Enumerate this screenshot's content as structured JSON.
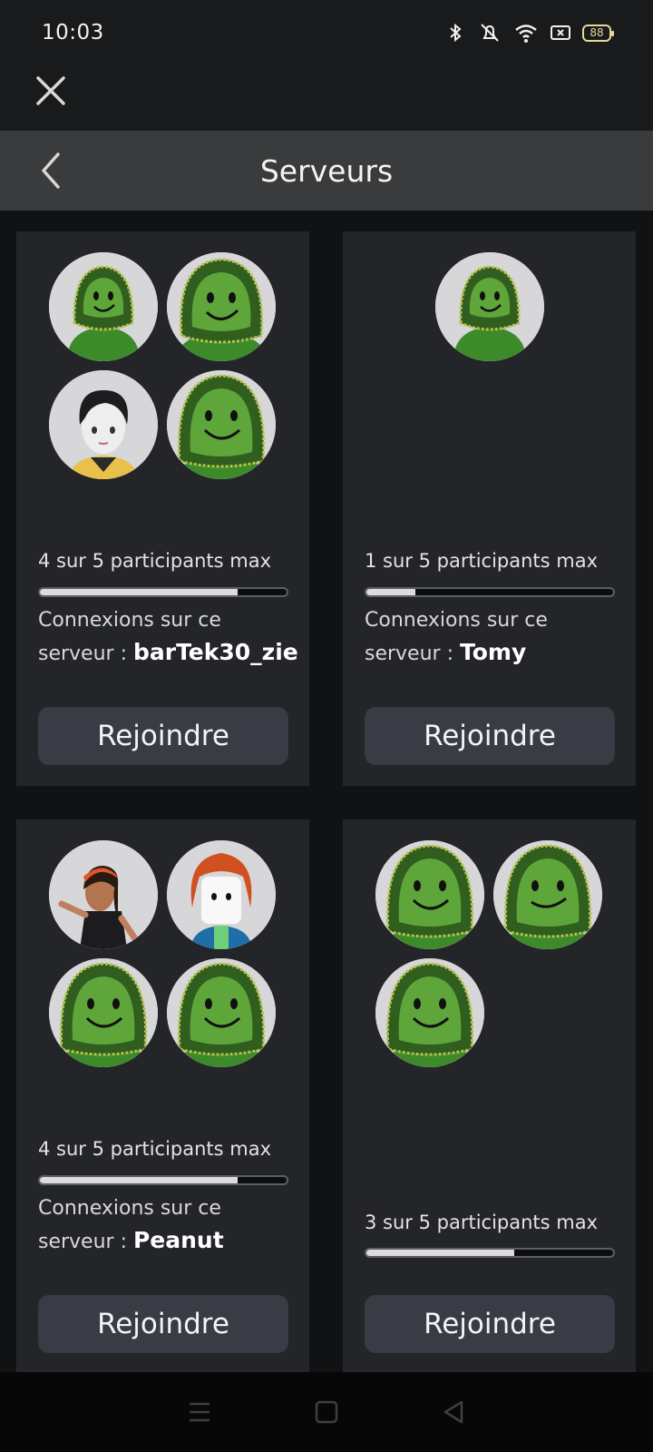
{
  "status_bar": {
    "time": "10:03",
    "battery": "88",
    "icons": [
      "bluetooth-icon",
      "mute-icon",
      "wifi-icon",
      "screen-icon",
      "battery-icon"
    ]
  },
  "header": {
    "title": "Serveurs"
  },
  "colors": {
    "background": "#111214",
    "card": "#232529",
    "header": "#393b3d",
    "button": "#393b45"
  },
  "servers": [
    {
      "count_text": "4 sur 5 participants max",
      "fill_fraction": 0.8,
      "connections_label": "Connexions sur ce serveur : ",
      "connection_name": "barTek30_zie",
      "join_label": "Rejoindre",
      "avatars": [
        "green-hood-avatar",
        "green-hood-avatar",
        "dark-hair-avatar",
        "green-hood-avatar"
      ]
    },
    {
      "count_text": "1 sur 5 participants max",
      "fill_fraction": 0.2,
      "connections_label": "Connexions sur ce serveur : ",
      "connection_name": "Tomy",
      "join_label": "Rejoindre",
      "avatars": [
        "green-hood-avatar"
      ]
    },
    {
      "count_text": "4 sur 5 participants max",
      "fill_fraction": 0.8,
      "connections_label": "Connexions sur ce serveur : ",
      "connection_name": "Peanut",
      "join_label": "Rejoindre",
      "avatars": [
        "orange-hair-girl-avatar",
        "red-hair-avatar",
        "green-hood-avatar",
        "green-hood-avatar"
      ]
    },
    {
      "count_text": "3 sur 5 participants max",
      "fill_fraction": 0.6,
      "join_label": "Rejoindre",
      "avatars": [
        "green-hood-avatar",
        "green-hood-avatar",
        "green-hood-avatar"
      ]
    }
  ],
  "nav_bar": {
    "icons": [
      "menu-icon",
      "home-icon",
      "back-icon"
    ]
  }
}
